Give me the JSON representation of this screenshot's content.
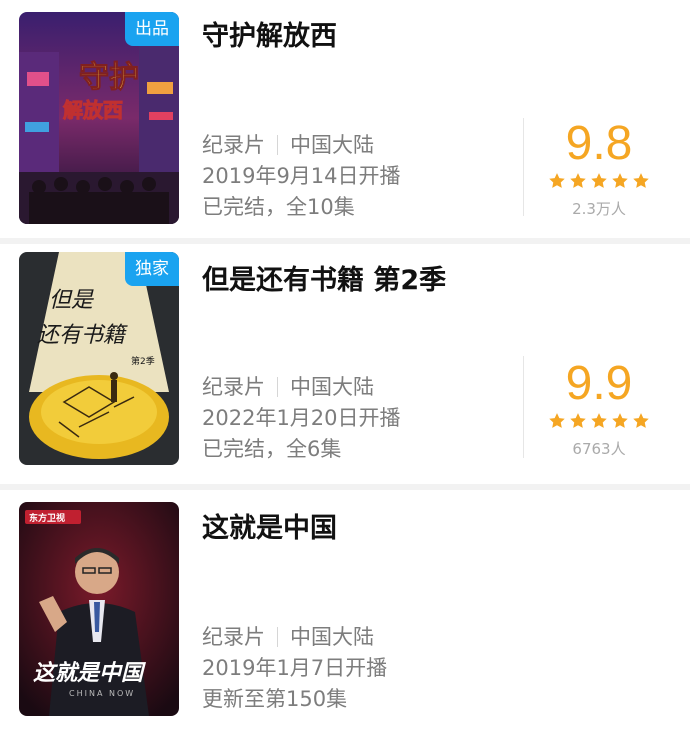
{
  "items": [
    {
      "title": "守护解放西",
      "badge": "出品",
      "genre": "纪录片",
      "region": "中国大陆",
      "premiere": "2019年9月14日开播",
      "status": "已完结，全10集",
      "score": "9.8",
      "stars": 5,
      "votes": "2.3万人",
      "poster_icon": "neon-street-poster",
      "poster_text": [
        "守护",
        "解放西"
      ]
    },
    {
      "title": "但是还有书籍 第2季",
      "badge": "独家",
      "genre": "纪录片",
      "region": "中国大陆",
      "premiere": "2022年1月20日开播",
      "status": "已完结，全6集",
      "score": "9.9",
      "stars": 5,
      "votes": "6763人",
      "poster_icon": "books-spotlight-poster",
      "poster_text": [
        "但是",
        "还有书籍",
        "第2季"
      ]
    },
    {
      "title": "这就是中国",
      "badge": "",
      "genre": "纪录片",
      "region": "中国大陆",
      "premiere": "2019年1月7日开播",
      "status": "更新至第150集",
      "poster_icon": "speaker-stage-poster",
      "poster_text": [
        "东方卫视",
        "这就是中国",
        "CHINA NOW"
      ]
    }
  ],
  "colors": {
    "badge": "#1aa3f0",
    "score": "#f5a623",
    "meta": "#7d7d7d"
  }
}
